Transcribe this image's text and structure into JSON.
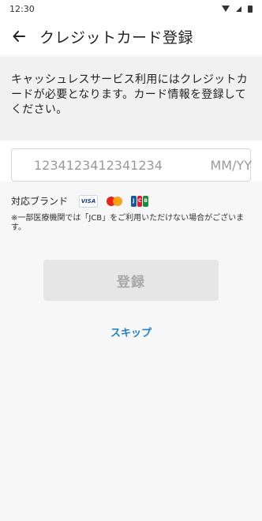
{
  "status_bar": {
    "time": "12:30"
  },
  "app_bar": {
    "title": "クレジットカード登録"
  },
  "intro": {
    "text": "キャッシュレスサービス利用にはクレジットカードが必要となります。カード情報を登録してください。"
  },
  "card_form": {
    "number_placeholder": "1234123412341234",
    "expiry_placeholder": "MM/YY"
  },
  "brands": {
    "label": "対応ブランド",
    "visa": "VISA",
    "jcb": [
      "J",
      "C",
      "B"
    ]
  },
  "note": "※一部医療機関では「JCB」をご利用いただけない場合がございます。",
  "actions": {
    "register_label": "登録",
    "skip_label": "スキップ"
  },
  "colors": {
    "accent": "#1f7fd0",
    "button_disabled_bg": "#e6e6e6",
    "button_disabled_text": "#a8a8a8"
  }
}
